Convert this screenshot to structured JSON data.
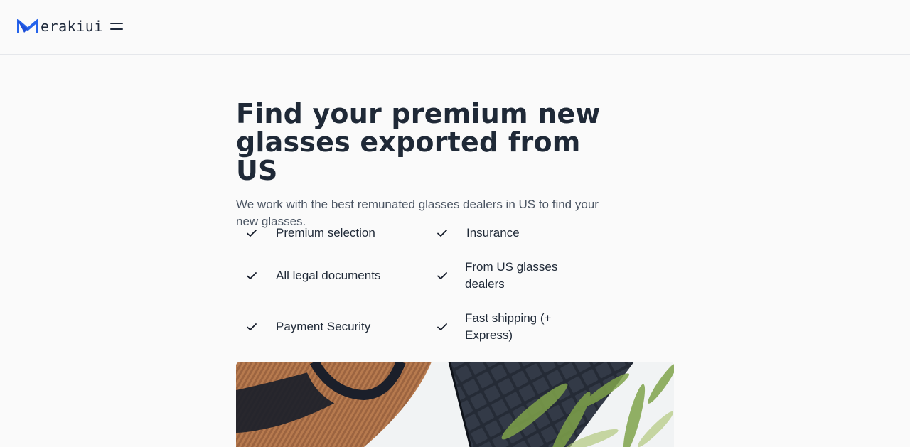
{
  "brand": {
    "name": "erakiui",
    "logo_icon": "merakiui-m-logo",
    "color": "#2563eb"
  },
  "header": {
    "menu_icon": "hamburger-menu-icon"
  },
  "hero": {
    "title": "Find your premium new glasses exported from US",
    "subtitle": "We work with the best remunated glasses dealers in US to find your new glasses."
  },
  "features": [
    {
      "label": "Premium selection",
      "icon": "check-icon"
    },
    {
      "label": "Insurance",
      "icon": "check-icon"
    },
    {
      "label": "All legal documents",
      "icon": "check-icon"
    },
    {
      "label": "From US glasses dealers",
      "icon": "check-icon"
    },
    {
      "label": "Payment Security",
      "icon": "check-icon"
    },
    {
      "label": "Fast shipping (+ Express)",
      "icon": "check-icon"
    }
  ],
  "image": {
    "subject": "straw hat, laptop and plant on white desk"
  }
}
